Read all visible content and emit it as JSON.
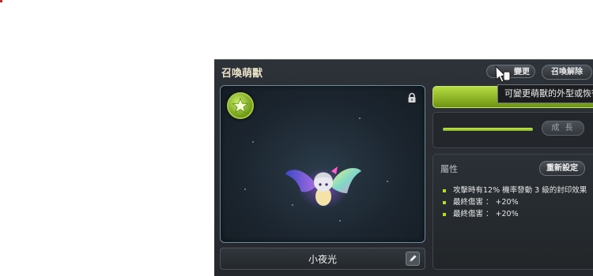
{
  "window": {
    "title": "召喚萌獸"
  },
  "top_buttons": {
    "change_label": "變更",
    "release_label": "召喚解除"
  },
  "tooltip": {
    "text": "可變更萌獸的外型或恢復"
  },
  "pet": {
    "name": "小夜光"
  },
  "growth": {
    "button_label": "成 長",
    "progress_fraction": 0.97
  },
  "attributes": {
    "title": "屬性",
    "reset_label": "重新設定",
    "items": [
      "攻擊時有12% 機率發動 3 級的封印效果",
      "最終傷害 ： +20%",
      "最終傷害 ： +20%"
    ]
  },
  "colors": {
    "accent_green": "#9cc82d",
    "panel_bg": "#2b3035"
  },
  "icons": {
    "badge": "star-icon",
    "lock": "lock-icon",
    "edit": "pencil-icon",
    "cursor": "hand-cursor-icon"
  }
}
